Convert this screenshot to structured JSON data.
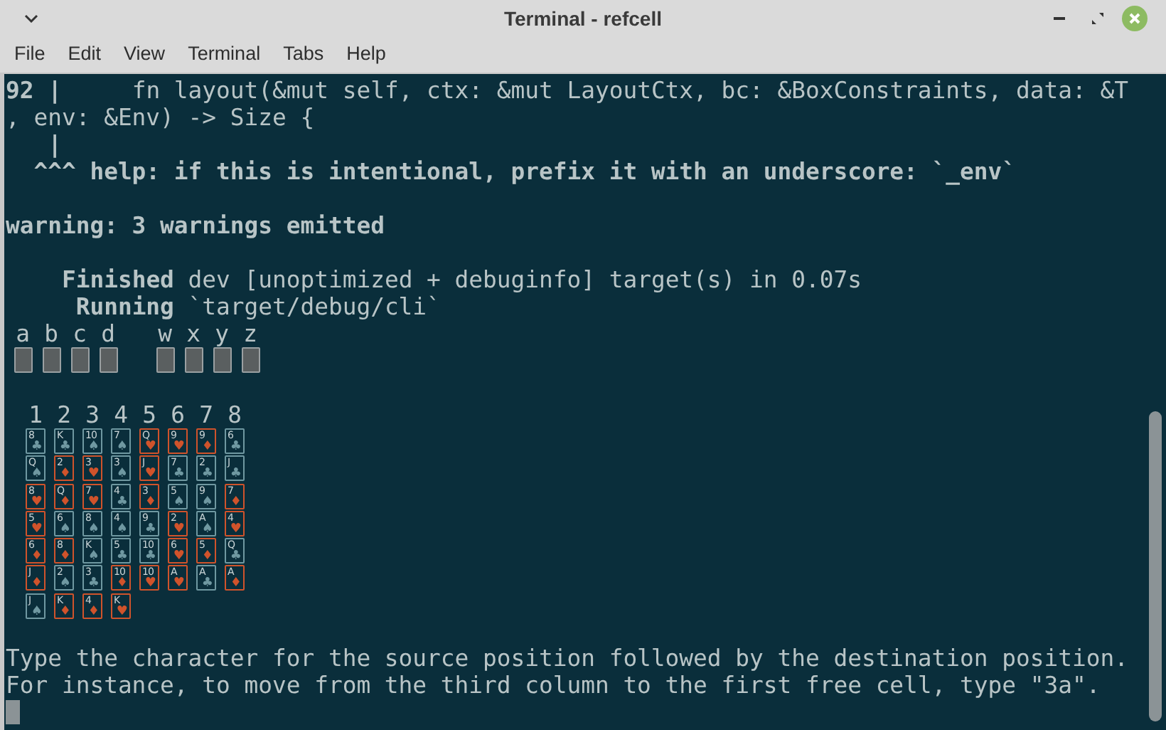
{
  "window": {
    "title": "Terminal - refcell"
  },
  "menu": [
    {
      "label": "File"
    },
    {
      "label": "Edit"
    },
    {
      "label": "View"
    },
    {
      "label": "Terminal"
    },
    {
      "label": "Tabs"
    },
    {
      "label": "Help"
    }
  ],
  "output": [
    {
      "text": "**92 |**     fn layout(&mut self, ctx: &mut LayoutCtx, bc: &BoxConstraints, data: &T",
      "bold": false,
      "blank_before": false
    },
    {
      "text": ", env: &Env) -> Size {",
      "bold": false,
      "blank_before": false
    },
    {
      "text": "   |",
      "bold": true,
      "blank_before": false
    },
    {
      "text": "  ^^^ help: if this is intentional, prefix it with an underscore: `_env`",
      "bold": true,
      "blank_before": false
    },
    {
      "text": "warning: 3 warnings emitted",
      "bold": true,
      "blank_before": true
    },
    {
      "text": "    **Finished** dev [unoptimized + debuginfo] target(s) in 0.07s",
      "bold": false,
      "blank_before": true
    },
    {
      "text": "     **Running** `target/debug/cli`",
      "bold": false,
      "blank_before": false
    }
  ],
  "game": {
    "free_cells": [
      {
        "label": "a"
      },
      {
        "label": "b"
      },
      {
        "label": "c"
      },
      {
        "label": "d"
      }
    ],
    "foundations": [
      {
        "label": "w"
      },
      {
        "label": "x"
      },
      {
        "label": "y"
      },
      {
        "label": "z"
      }
    ],
    "columns": [
      {
        "label": "1",
        "cards": [
          {
            "rank": "8",
            "suit": "♣",
            "color": "#6f98a1"
          },
          {
            "rank": "Q",
            "suit": "♠",
            "color": "#6f98a1"
          },
          {
            "rank": "8",
            "suit": "♥",
            "color": "#d0532b"
          },
          {
            "rank": "5",
            "suit": "♥",
            "color": "#d0532b"
          },
          {
            "rank": "6",
            "suit": "♦",
            "color": "#d0532b"
          },
          {
            "rank": "J",
            "suit": "♦",
            "color": "#d0532b"
          },
          {
            "rank": "J",
            "suit": "♠",
            "color": "#6f98a1"
          }
        ]
      },
      {
        "label": "2",
        "cards": [
          {
            "rank": "K",
            "suit": "♣",
            "color": "#6f98a1"
          },
          {
            "rank": "2",
            "suit": "♦",
            "color": "#d0532b"
          },
          {
            "rank": "Q",
            "suit": "♦",
            "color": "#d0532b"
          },
          {
            "rank": "6",
            "suit": "♠",
            "color": "#6f98a1"
          },
          {
            "rank": "8",
            "suit": "♦",
            "color": "#d0532b"
          },
          {
            "rank": "2",
            "suit": "♠",
            "color": "#6f98a1"
          },
          {
            "rank": "K",
            "suit": "♦",
            "color": "#d0532b"
          }
        ]
      },
      {
        "label": "3",
        "cards": [
          {
            "rank": "10",
            "suit": "♠",
            "color": "#6f98a1"
          },
          {
            "rank": "3",
            "suit": "♥",
            "color": "#d0532b"
          },
          {
            "rank": "7",
            "suit": "♥",
            "color": "#d0532b"
          },
          {
            "rank": "8",
            "suit": "♠",
            "color": "#6f98a1"
          },
          {
            "rank": "K",
            "suit": "♠",
            "color": "#6f98a1"
          },
          {
            "rank": "3",
            "suit": "♣",
            "color": "#6f98a1"
          },
          {
            "rank": "4",
            "suit": "♦",
            "color": "#d0532b"
          }
        ]
      },
      {
        "label": "4",
        "cards": [
          {
            "rank": "7",
            "suit": "♠",
            "color": "#6f98a1"
          },
          {
            "rank": "3",
            "suit": "♠",
            "color": "#6f98a1"
          },
          {
            "rank": "4",
            "suit": "♣",
            "color": "#6f98a1"
          },
          {
            "rank": "4",
            "suit": "♠",
            "color": "#6f98a1"
          },
          {
            "rank": "5",
            "suit": "♣",
            "color": "#6f98a1"
          },
          {
            "rank": "10",
            "suit": "♦",
            "color": "#d0532b"
          },
          {
            "rank": "K",
            "suit": "♥",
            "color": "#d0532b"
          }
        ]
      },
      {
        "label": "5",
        "cards": [
          {
            "rank": "Q",
            "suit": "♥",
            "color": "#d0532b"
          },
          {
            "rank": "J",
            "suit": "♥",
            "color": "#d0532b"
          },
          {
            "rank": "3",
            "suit": "♦",
            "color": "#d0532b"
          },
          {
            "rank": "9",
            "suit": "♣",
            "color": "#6f98a1"
          },
          {
            "rank": "10",
            "suit": "♣",
            "color": "#6f98a1"
          },
          {
            "rank": "10",
            "suit": "♥",
            "color": "#d0532b"
          }
        ]
      },
      {
        "label": "6",
        "cards": [
          {
            "rank": "9",
            "suit": "♥",
            "color": "#d0532b"
          },
          {
            "rank": "7",
            "suit": "♣",
            "color": "#6f98a1"
          },
          {
            "rank": "5",
            "suit": "♠",
            "color": "#6f98a1"
          },
          {
            "rank": "2",
            "suit": "♥",
            "color": "#d0532b"
          },
          {
            "rank": "6",
            "suit": "♥",
            "color": "#d0532b"
          },
          {
            "rank": "A",
            "suit": "♥",
            "color": "#d0532b"
          }
        ]
      },
      {
        "label": "7",
        "cards": [
          {
            "rank": "9",
            "suit": "♦",
            "color": "#d0532b"
          },
          {
            "rank": "2",
            "suit": "♣",
            "color": "#6f98a1"
          },
          {
            "rank": "9",
            "suit": "♠",
            "color": "#6f98a1"
          },
          {
            "rank": "A",
            "suit": "♠",
            "color": "#6f98a1"
          },
          {
            "rank": "5",
            "suit": "♦",
            "color": "#d0532b"
          },
          {
            "rank": "A",
            "suit": "♣",
            "color": "#6f98a1"
          }
        ]
      },
      {
        "label": "8",
        "cards": [
          {
            "rank": "6",
            "suit": "♣",
            "color": "#6f98a1"
          },
          {
            "rank": "J",
            "suit": "♣",
            "color": "#6f98a1"
          },
          {
            "rank": "7",
            "suit": "♦",
            "color": "#d0532b"
          },
          {
            "rank": "4",
            "suit": "♥",
            "color": "#d0532b"
          },
          {
            "rank": "Q",
            "suit": "♣",
            "color": "#6f98a1"
          },
          {
            "rank": "A",
            "suit": "♦",
            "color": "#d0532b"
          }
        ]
      }
    ]
  },
  "prompt": [
    {
      "text": "Type the character for the source position followed by the destination position."
    },
    {
      "text": "For instance, to move from the third column to the first free cell, type \"3a\"."
    }
  ]
}
